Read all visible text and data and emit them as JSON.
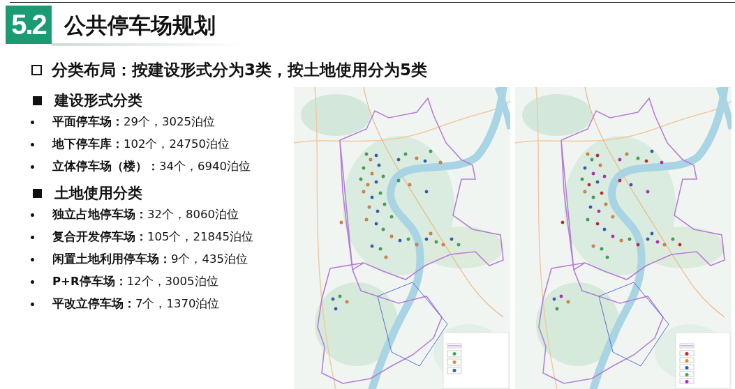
{
  "header": {
    "section_number": "5.2",
    "title": "公共停车场规划"
  },
  "subtitle": "分类布局：按建设形式分为3类，按土地使用分为5类",
  "groups": [
    {
      "heading": "建设形式分类",
      "items": [
        "**平面停车场：**29个，3025泊位",
        "**地下停车库：**102个，24750泊位",
        "**立体停车场（楼）：**34个，6940泊位"
      ]
    },
    {
      "heading": "土地使用分类",
      "items": [
        "**独立占地停车场：**32个，8060泊位",
        "**复合开发停车场：**105个，21845泊位",
        "**闲置土地利用停车场：**9个，435泊位",
        "**P+R停车场：**12个，3005泊位",
        "**平改立停车场：**7个，1370泊位"
      ]
    }
  ]
}
